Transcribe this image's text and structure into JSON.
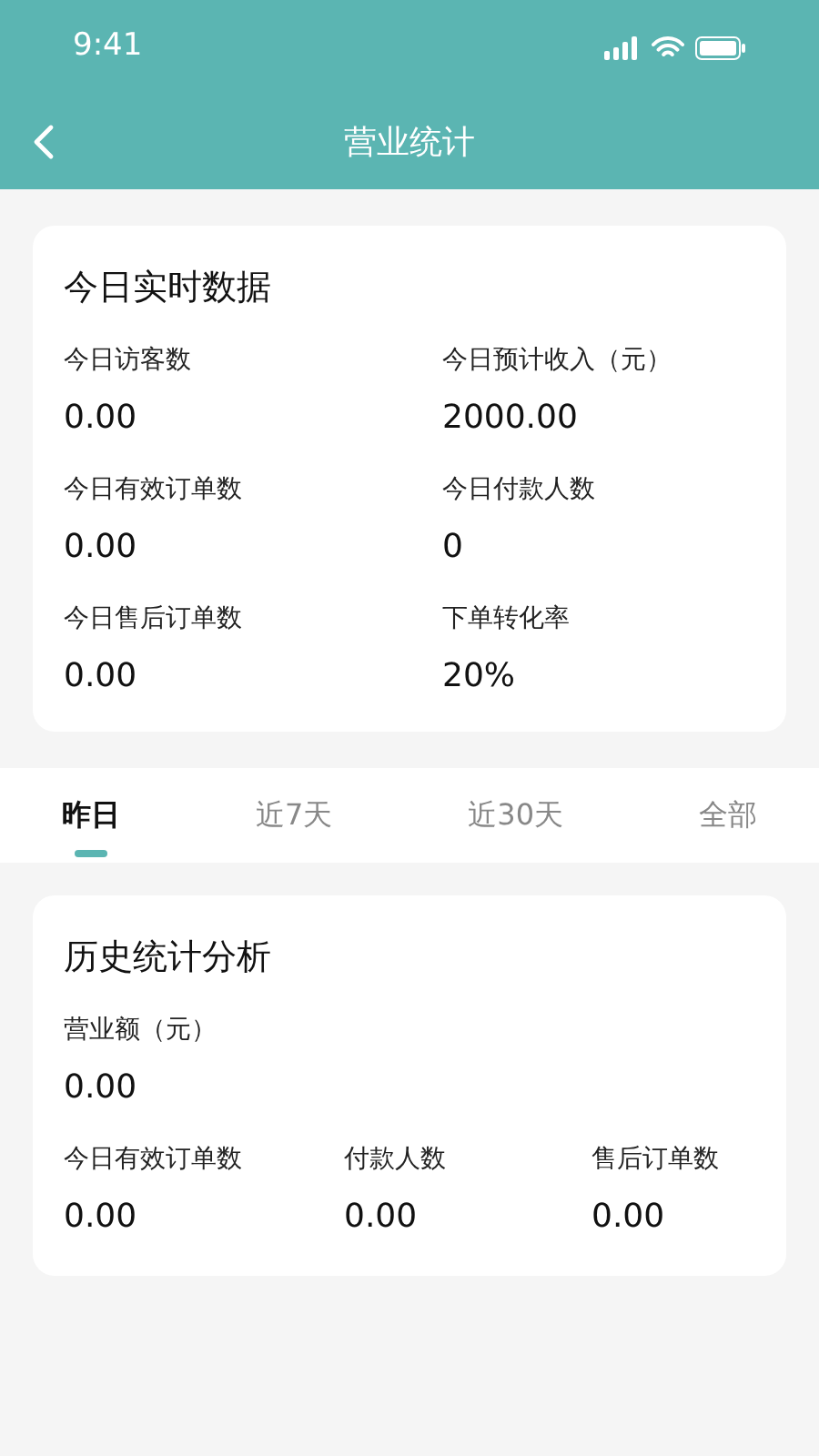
{
  "status_bar": {
    "time": "9:41"
  },
  "header": {
    "title": "营业统计"
  },
  "realtime": {
    "title": "今日实时数据",
    "stats": [
      {
        "label": "今日访客数",
        "value": "0.00"
      },
      {
        "label": "今日预计收入（元）",
        "value": "2000.00"
      },
      {
        "label": "今日有效订单数",
        "value": "0.00"
      },
      {
        "label": "今日付款人数",
        "value": "0"
      },
      {
        "label": "今日售后订单数",
        "value": "0.00"
      },
      {
        "label": "下单转化率",
        "value": "20%"
      }
    ]
  },
  "tabs": [
    {
      "label": "昨日",
      "selected": true
    },
    {
      "label": "近7天",
      "selected": false
    },
    {
      "label": "近30天",
      "selected": false
    },
    {
      "label": "全部",
      "selected": false
    }
  ],
  "history": {
    "title": "历史统计分析",
    "revenue": {
      "label": "营业额（元）",
      "value": "0.00"
    },
    "stats": [
      {
        "label": "今日有效订单数",
        "value": "0.00"
      },
      {
        "label": "付款人数",
        "value": "0.00"
      },
      {
        "label": "售后订单数",
        "value": "0.00"
      }
    ]
  }
}
